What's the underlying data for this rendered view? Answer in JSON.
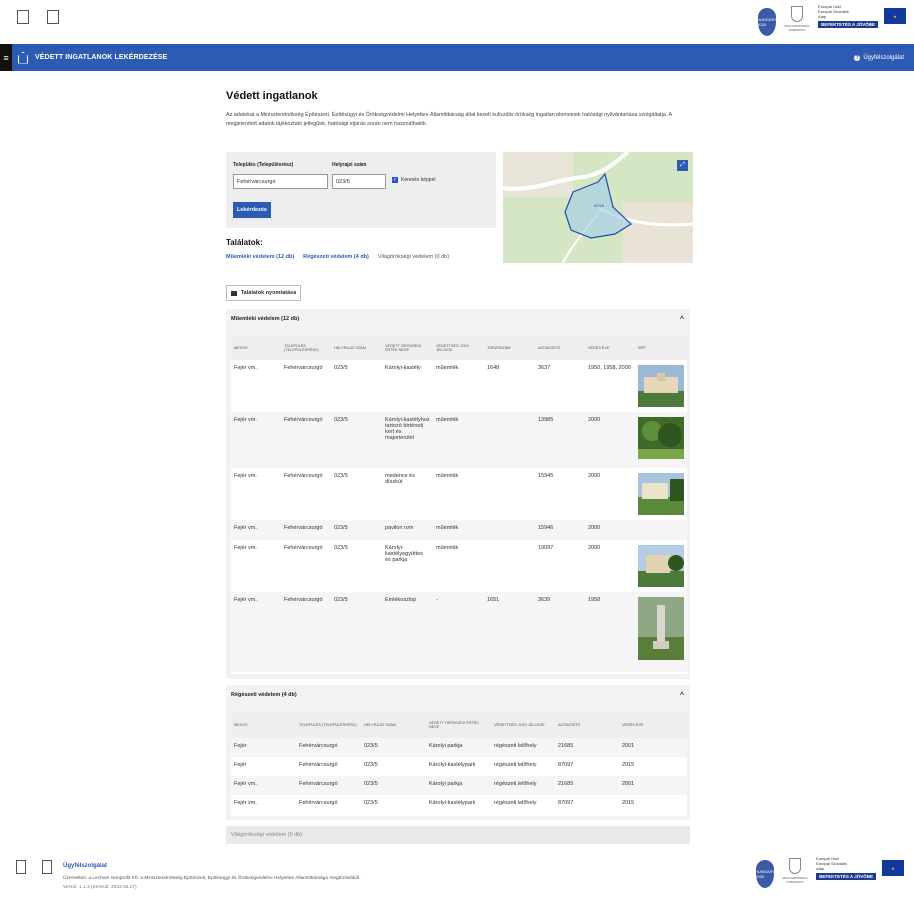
{
  "header": {
    "left_logos": [
      "",
      ""
    ],
    "pin_text": "HUNGARY 2030",
    "coat_text": "MAGYARORSZÁG KORMÁNYA",
    "eu_text": [
      "Európai Unió",
      "Európai Szociális",
      "Alap"
    ],
    "eu_banner": "BEFEKTETÉS A JÖVŐBE"
  },
  "nav": {
    "title": "VÉDETT INGATLANOK LEKÉRDEZÉSE",
    "help": "Ügyfélszolgálat"
  },
  "page": {
    "title": "Védett ingatlanok",
    "intro": "Az adatokat a Miniszterelnökség Építészeti, Építésügyi és Örökségvédelmi Helyettes Államtitkárság által kezelt kulturális örökség ingatlan elemeinek hatósági nyilvántartása szolgáltatja. A megjelenített adatok tájékoztató jellegűek, hatósági eljárás során nem használhatók."
  },
  "search": {
    "settlement_label": "Település (Településrész)",
    "settlement_value": "Fehérvárcsurgó",
    "lot_label": "Helyrajzi szám",
    "lot_value": "023/5",
    "checkbox_label": "Keresés képpel",
    "submit_label": "Lekérdezés"
  },
  "map": {
    "label_text": "023/5"
  },
  "results": {
    "label": "Találatok:",
    "links": [
      "Műemléki védelem (12 db)",
      "Régészeti védelem (4 db)",
      "Világörökségi védelem (0 db)"
    ],
    "print_label": "Találatok nyomtatása"
  },
  "sections": {
    "monument_title": "Műemléki védelem (12 db)",
    "arch_title": "Régészeti védelem (4 db)",
    "world_title": "Világörökségi védelem (0 db)"
  },
  "monument_table": {
    "headers": [
      "MEGYE",
      "TELEPÜLÉS (TELEPÜLÉSRÉSZ)",
      "HELYRAJZI SZÁM",
      "VÉDETT ÖRÖKSÉGI ÉRTÉK NEVE",
      "VÉDETTSÉG JOGI JELLEGE",
      "TÖRZSSZÁM",
      "AZONOSÍTÓ",
      "VÉDÉS ÉVE",
      "KÉP"
    ],
    "rows": [
      [
        "Fejér vm.",
        "Fehérvárcsurgó",
        "023/5",
        "Károlyi-kastély",
        "műemlék",
        "1648",
        "3637",
        "1950, 1958, 2000"
      ],
      [
        "Fejér vm.",
        "Fehérvárcsurgó",
        "023/5",
        "Károlyi-kastélyhoz tartozó történeti kert és majorterület",
        "műemlék",
        "",
        "13985",
        "2000"
      ],
      [
        "Fejér vm.",
        "Fehérvárcsurgó",
        "023/5",
        "medence és díszkút",
        "műemlék",
        "",
        "15945",
        "2000"
      ],
      [
        "Fejér vm.",
        "Fehérvárcsurgó",
        "023/5",
        "pavilon rom",
        "műemlék",
        "",
        "15946",
        "2000"
      ],
      [
        "Fejér vm.",
        "Fehérvárcsurgó",
        "023/5",
        "Károlyi-kastélyegyüttes és parkja",
        "műemlék",
        "",
        "19097",
        "2000"
      ],
      [
        "Fejér vm.",
        "Fehérvárcsurgó",
        "023/5",
        "Emlékoszlop",
        "-",
        "1651",
        "3639",
        "1958"
      ]
    ]
  },
  "arch_table": {
    "headers": [
      "MEGYE",
      "TELEPÜLÉS (TELEPÜLÉSRÉSZ)",
      "HELYRAJZI SZÁM",
      "VÉDETT ÖRÖKSÉGI ÉRTÉK NEVE",
      "VÉDETTSÉG JOGI JELLEGE",
      "AZONOSÍTÓ",
      "VÉDÉS ÉVE"
    ],
    "rows": [
      [
        "Fejér",
        "Fehérvárcsurgó",
        "023/5",
        "Károlyi parkja",
        "régészeti lelőhely",
        "21685",
        "2001"
      ],
      [
        "Fejér",
        "Fehérvárcsurgó",
        "023/5",
        "Károlyi-kastélypark",
        "régészeti lelőhely",
        "87097",
        "2015"
      ],
      [
        "Fejér vm.",
        "Fehérvárcsurgó",
        "023/5",
        "Károlyi parkja",
        "régészeti lelőhely",
        "21685",
        "2001"
      ],
      [
        "Fejér vm.",
        "Fehérvárcsurgó",
        "023/5",
        "Károlyi-kastélypark",
        "régészeti lelőhely",
        "87097",
        "2015"
      ]
    ]
  },
  "footer": {
    "title": "Ügyfélszolgálat",
    "text": "Üzemelteti: a Lechner Nonprofit Kft. a Miniszterelnökség Építészeti, Építésügyi és Örökségvédelmi Helyettes Államtitkársága megbízásából.",
    "version": "Verzió: 1.1.3 (Készült: 2023.06.17)"
  },
  "colors": {
    "primary": "#2d5bb3",
    "panel": "#eeeeee",
    "eu_blue": "#1e3d8f"
  }
}
